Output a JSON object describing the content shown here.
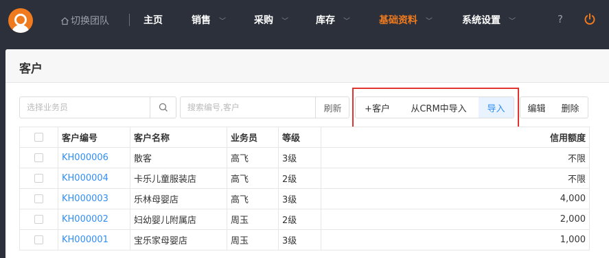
{
  "nav": {
    "team_label": "切换团队",
    "items": [
      {
        "label": "主页",
        "chevron": false,
        "active": false
      },
      {
        "label": "销售",
        "chevron": true,
        "active": false
      },
      {
        "label": "采购",
        "chevron": true,
        "active": false
      },
      {
        "label": "库存",
        "chevron": true,
        "active": false
      },
      {
        "label": "基础资料",
        "chevron": true,
        "active": true
      },
      {
        "label": "系统设置",
        "chevron": true,
        "active": false
      }
    ],
    "help_label": "?",
    "accent_color": "#f07a1e"
  },
  "page": {
    "title": "客户"
  },
  "toolbar": {
    "salesperson_placeholder": "选择业务员",
    "search_placeholder": "搜索编号,客户",
    "refresh_label": "刷新",
    "add_customer_label": "+客户",
    "import_crm_label": "从CRM中导入",
    "import_label": "导入",
    "edit_label": "编辑",
    "delete_label": "删除"
  },
  "table": {
    "columns": [
      "客户编号",
      "客户名称",
      "业务员",
      "等级",
      "信用额度"
    ],
    "rows": [
      [
        "KH000006",
        "散客",
        "高飞",
        "3级",
        "不限"
      ],
      [
        "KH000004",
        "卡乐儿童服装店",
        "高飞",
        "2级",
        "不限"
      ],
      [
        "KH000003",
        "乐林母婴店",
        "高飞",
        "3级",
        "4,000"
      ],
      [
        "KH000002",
        "妇幼婴儿附属店",
        "周玉",
        "2级",
        "2,000"
      ],
      [
        "KH000001",
        "宝乐家母婴店",
        "周玉",
        "3级",
        "1,000"
      ]
    ]
  }
}
